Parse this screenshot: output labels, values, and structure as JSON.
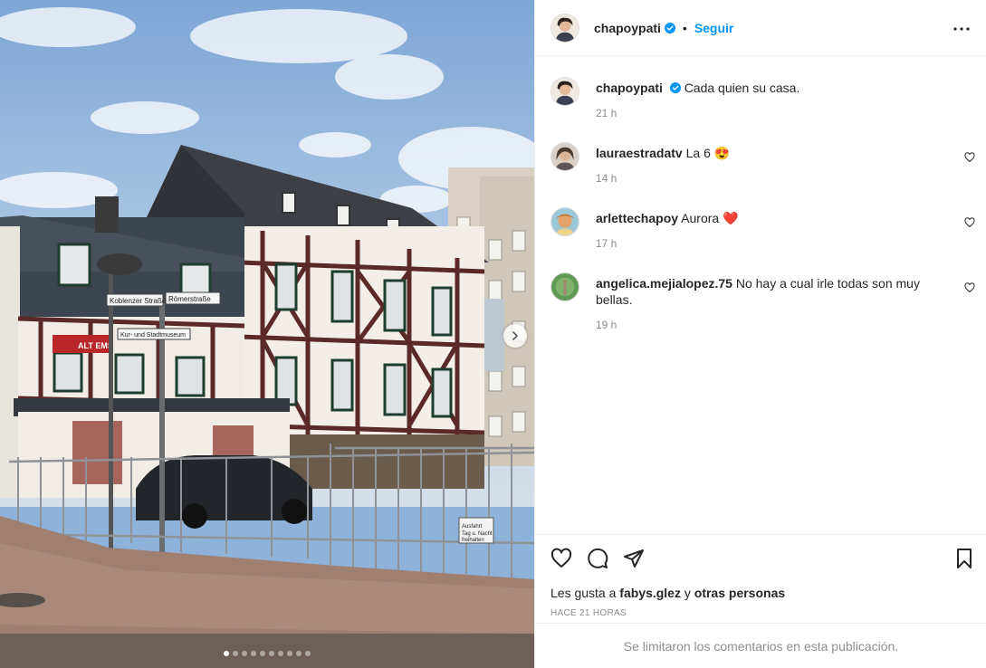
{
  "post": {
    "author": "chapoypati",
    "verified": true,
    "separator": "•",
    "follow_label": "Seguir",
    "caption": "Cada quien su casa.",
    "caption_time": "21 h",
    "image_alt": "Casa de entramado de madera en una esquina con letreros Koblenzer Straße y Römerstraße",
    "street_signs": [
      "Koblenzer Straße",
      "Römerstraße",
      "Kur- und Stadtmuseum",
      "ALT EMS",
      "Ausfahrt Tag u. Nacht freihalten"
    ],
    "carousel": {
      "total_images": 10,
      "current_index": 0
    }
  },
  "comments": [
    {
      "username": "lauraestradatv",
      "text": "La 6",
      "emoji": "😍",
      "time": "14 h",
      "avatar_color": "#6b5a4a"
    },
    {
      "username": "arlettechapoy",
      "text": "Aurora",
      "emoji": "❤️",
      "time": "17 h",
      "avatar_color": "#d9a36a"
    },
    {
      "username": "angelica.mejialopez.75",
      "text": "No hay a cual irle todas son muy bellas.",
      "emoji": "",
      "time": "19 h",
      "avatar_color": "#4d8a4a"
    }
  ],
  "likes": {
    "prefix": "Les gusta a",
    "user": "fabys.glez",
    "conjunction": "y",
    "others": "otras personas"
  },
  "post_date": "HACE 21 HORAS",
  "comments_limited_notice": "Se limitaron los comentarios en esta publicación.",
  "icons": {
    "like": "heart-icon",
    "comment": "comment-bubble-icon",
    "share": "paper-plane-icon",
    "save": "bookmark-icon",
    "more": "ellipsis-icon",
    "next": "chevron-right-icon",
    "verified": "verified-badge-icon"
  },
  "colors": {
    "link_blue": "#0095f6",
    "verified_blue": "#0095f6",
    "muted_text": "#8e8e8e",
    "border": "#efefef"
  }
}
